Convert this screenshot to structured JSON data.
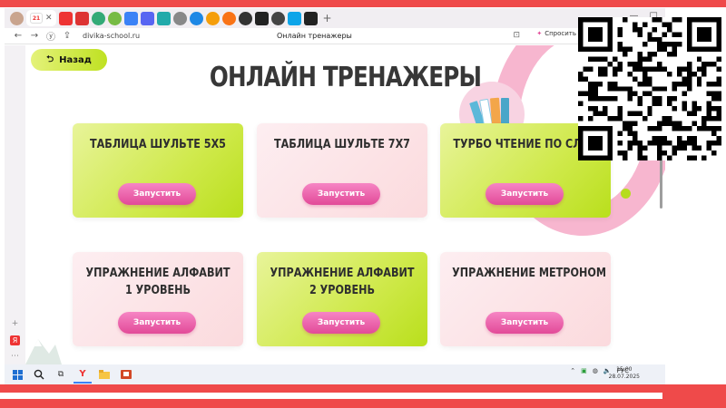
{
  "browser": {
    "tab_badge": "21",
    "url": "divika-school.ru",
    "tab_title": "Онлайн тренажеры",
    "ask_label": "Спросить"
  },
  "page": {
    "back_label": "Назад",
    "title": "ОНЛАЙН ТРЕНАЖЕРЫ",
    "cards": [
      {
        "title": "ТАБЛИЦА ШУЛЬТЕ 5Х5",
        "button": "Запустить",
        "variant": "green"
      },
      {
        "title": "ТАБЛИЦА ШУЛЬТЕ 7Х7",
        "button": "Запустить",
        "variant": "pink"
      },
      {
        "title": "ТУРБО ЧТЕНИЕ ПО СЛОВ",
        "button": "Запустить",
        "variant": "green"
      },
      {
        "title": "УПРАЖНЕНИЕ АЛФАВИТ",
        "title2": "1 УРОВЕНЬ",
        "button": "Запустить",
        "variant": "pink"
      },
      {
        "title": "УПРАЖНЕНИЕ АЛФАВИТ",
        "title2": "2 УРОВЕНЬ",
        "button": "Запустить",
        "variant": "green"
      },
      {
        "title": "УПРАЖНЕНИЕ МЕТРОНОМ",
        "button": "Запустить",
        "variant": "pink"
      }
    ]
  },
  "taskbar": {
    "lang": "РУС",
    "time": "15:00",
    "date": "28.07.2025"
  },
  "colors": {
    "accent_red": "#ef4a4a",
    "card_green": "#cfe94a",
    "card_pink": "#fbdadd",
    "button_pink": "#e24a98",
    "title_text": "#373737"
  }
}
